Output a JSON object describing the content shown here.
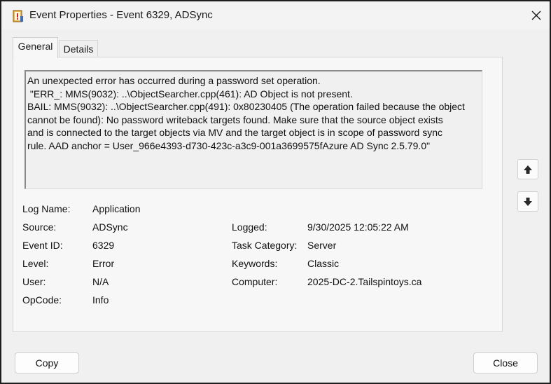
{
  "window": {
    "title": "Event Properties - Event 6329, ADSync",
    "close_glyph": "✕"
  },
  "tabs": [
    {
      "label": "General",
      "active": true
    },
    {
      "label": "Details",
      "active": false
    }
  ],
  "message": {
    "lines": [
      "An unexpected error has occurred during a password set operation.",
      " \"ERR_: MMS(9032): ..\\ObjectSearcher.cpp(461): AD Object is not present.",
      "BAIL: MMS(9032): ..\\ObjectSearcher.cpp(491): 0x80230405 (The operation failed because the object",
      "cannot be found): No password writeback targets found. Make sure that the source object exists",
      "and is connected to the target objects via MV and the target object is in scope of password sync",
      "rule. AAD anchor = User_966e4393-d730-423c-a3c9-001a3699575fAzure AD Sync 2.5.79.0\""
    ]
  },
  "details": {
    "log_name": {
      "label": "Log Name:",
      "value": "Application"
    },
    "source": {
      "label": "Source:",
      "value": "ADSync"
    },
    "logged": {
      "label": "Logged:",
      "value": "9/30/2025 12:05:22 AM"
    },
    "event_id": {
      "label": "Event ID:",
      "value": "6329"
    },
    "task_category": {
      "label": "Task Category:",
      "value": "Server"
    },
    "level": {
      "label": "Level:",
      "value": "Error"
    },
    "keywords": {
      "label": "Keywords:",
      "value": "Classic"
    },
    "user": {
      "label": "User:",
      "value": "N/A"
    },
    "computer": {
      "label": "Computer:",
      "value": "2025-DC-2.Tailspintoys.ca"
    },
    "opcode": {
      "label": "OpCode:",
      "value": "Info"
    }
  },
  "nav": {
    "up_icon": "arrow-up-icon",
    "down_icon": "arrow-down-icon"
  },
  "buttons": {
    "copy": "Copy",
    "close": "Close"
  },
  "colors": {
    "window_bg": "#f0f0f0",
    "panel_bg": "#f7f7f7",
    "border": "#1e1e1e"
  }
}
